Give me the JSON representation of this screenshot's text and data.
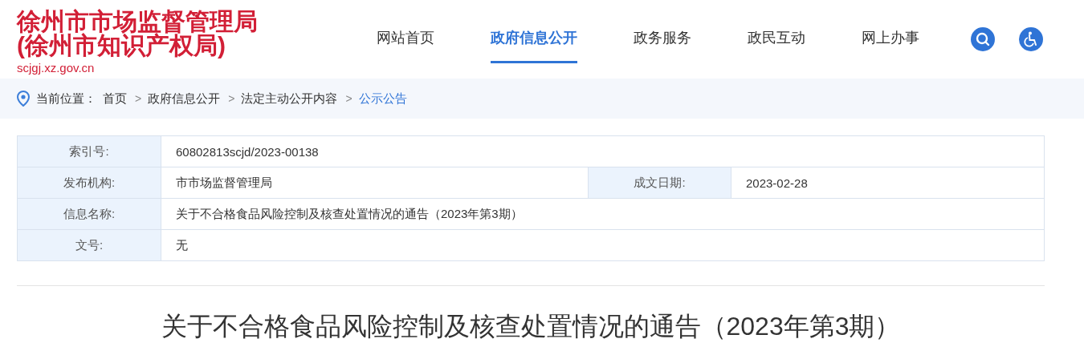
{
  "header": {
    "title_lines": [
      "徐州市市场监督管理局",
      "(徐州市知识产权局)"
    ],
    "url": "scjgj.xz.gov.cn"
  },
  "nav": [
    {
      "label": "网站首页",
      "selected": false
    },
    {
      "label": "政府信息公开",
      "selected": true
    },
    {
      "label": "政务服务",
      "selected": false
    },
    {
      "label": "政民互动",
      "selected": false
    },
    {
      "label": "网上办事",
      "selected": false
    }
  ],
  "breadcrumb": {
    "prefix": "当前位置：",
    "items": [
      {
        "label": "首页",
        "selected": false
      },
      {
        "separator": ">",
        "label": "政府信息公开",
        "selected": false
      },
      {
        "separator": ">",
        "label": "法定主动公开内容",
        "selected": false
      },
      {
        "separator": ">",
        "label": "公示公告",
        "selected": true
      }
    ]
  },
  "info_table": {
    "rows": [
      [
        {
          "label": "索引号:",
          "value": "60802813scjd/2023-00138"
        }
      ],
      [
        {
          "label": "发布机构:",
          "value": "市市场监督管理局"
        },
        {
          "label": "成文日期:",
          "value": "2023-02-28"
        }
      ],
      [
        {
          "label": "信息名称:",
          "value": "关于不合格食品风险控制及核查处置情况的通告（2023年第3期）"
        }
      ],
      [
        {
          "label": "文号:",
          "value": "无"
        }
      ]
    ]
  },
  "article": {
    "title": "关于不合格食品风险控制及核查处置情况的通告（2023年第3期）"
  }
}
